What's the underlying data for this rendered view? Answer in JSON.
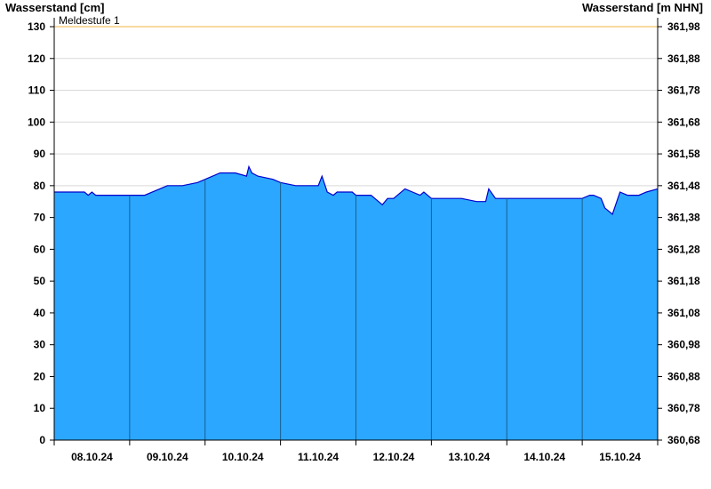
{
  "chart_data": {
    "type": "area",
    "ylabel_left": "Wasserstand [cm]",
    "ylabel_right": "Wasserstand [m NHN]",
    "ylim": [
      0,
      130
    ],
    "yticks_left": [
      0,
      10,
      20,
      30,
      40,
      50,
      60,
      70,
      80,
      90,
      100,
      110,
      120,
      130
    ],
    "yticks_right": [
      "360,68",
      "360,78",
      "360,88",
      "360,98",
      "361,08",
      "361,18",
      "361,28",
      "361,38",
      "361,48",
      "361,58",
      "361,68",
      "361,78",
      "361,88",
      "361,98"
    ],
    "x_ticks": [
      "08.10.24",
      "09.10.24",
      "10.10.24",
      "11.10.24",
      "12.10.24",
      "13.10.24",
      "14.10.24",
      "15.10.24"
    ],
    "x_range_days": [
      0,
      8
    ],
    "threshold": {
      "label": "Meldestufe 1",
      "value": 130,
      "color": "#f5c36a"
    },
    "colors": {
      "fill": "#2ba7ff",
      "line": "#0000cc",
      "grid": "#d9d9d9",
      "day_line": "#1a5f8f"
    },
    "series": [
      {
        "x": [
          0,
          0.2,
          0.4,
          0.45,
          0.5,
          0.55,
          0.7,
          0.9,
          1,
          1.2,
          1.4,
          1.5,
          1.7,
          1.9,
          2,
          2.2,
          2.4,
          2.55,
          2.58,
          2.62,
          2.7,
          2.9,
          3,
          3.2,
          3.35,
          3.4,
          3.5,
          3.55,
          3.62,
          3.7,
          3.75,
          3.85,
          3.95,
          4,
          4.2,
          4.35,
          4.42,
          4.5,
          4.65,
          4.75,
          4.85,
          4.9,
          5,
          5.2,
          5.4,
          5.6,
          5.72,
          5.76,
          5.85,
          6,
          6.2,
          6.4,
          6.6,
          6.8,
          6.95,
          7,
          7.1,
          7.15,
          7.25,
          7.3,
          7.4,
          7.5,
          7.6,
          7.75,
          7.85,
          8
        ],
        "y": [
          78,
          78,
          78,
          77,
          78,
          77,
          77,
          77,
          77,
          77,
          79,
          80,
          80,
          81,
          82,
          84,
          84,
          83,
          86,
          84,
          83,
          82,
          81,
          80,
          80,
          80,
          80,
          83,
          78,
          77,
          78,
          78,
          78,
          77,
          77,
          74,
          76,
          76,
          79,
          78,
          77,
          78,
          76,
          76,
          76,
          75,
          75,
          79,
          76,
          76,
          76,
          76,
          76,
          76,
          76,
          76,
          77,
          77,
          76,
          73,
          71,
          78,
          77,
          77,
          78,
          79
        ]
      }
    ]
  }
}
